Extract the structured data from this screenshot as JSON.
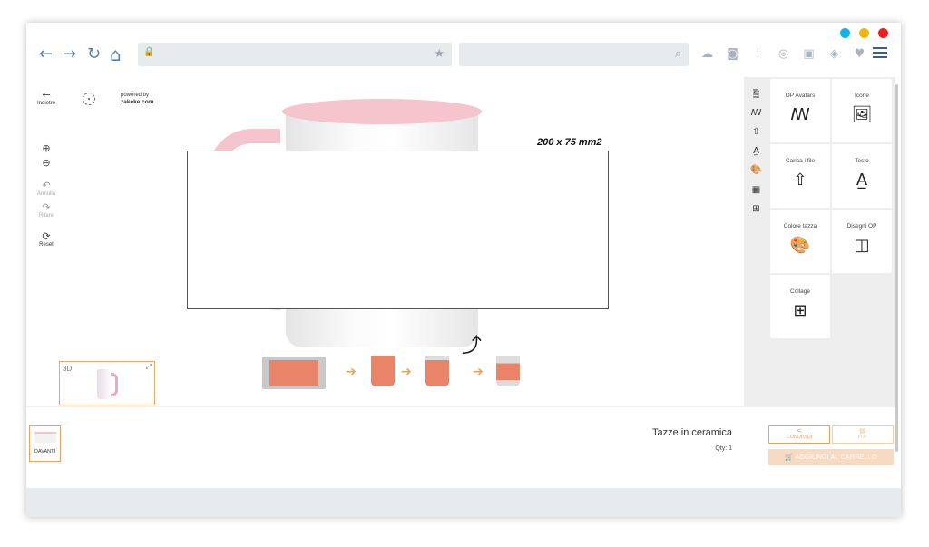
{
  "window": {
    "dot_colors": [
      "#0fb3ef",
      "#f5b800",
      "#ef1d1d"
    ]
  },
  "browser": {
    "back_glyph": "←",
    "forward_glyph": "→",
    "reload_glyph": "↻",
    "home_glyph": "⌂",
    "lock_glyph": "🔒",
    "star_glyph": "★",
    "search_glyph": "⌕",
    "toolbar_icons": [
      "cloud-upload-icon",
      "camera-icon",
      "alert-icon",
      "podcast-icon",
      "briefcase-icon",
      "shield-icon",
      "heart-icon"
    ],
    "toolbar_glyphs": [
      "☁",
      "◙",
      "!",
      "◎",
      "▣",
      "◈",
      "♥"
    ]
  },
  "left_tools": {
    "back_label": "Indietro",
    "back_glyph": "←",
    "zoom_in_glyph": "⊕",
    "zoom_out_glyph": "⊖",
    "undo_label": "Annulla",
    "undo_glyph": "↶",
    "redo_label": "Rifare",
    "redo_glyph": "↷",
    "reset_label": "Reset",
    "reset_glyph": "⟳"
  },
  "branding": {
    "powered_by": "powered by",
    "brand": "zakeke.com"
  },
  "canvas": {
    "dimensions_label": "200 x 75 mm2",
    "rotate_glyph": "⤴"
  },
  "preview3d": {
    "label": "3D",
    "expand_glyph": "⤢"
  },
  "side_strip": {
    "glyphs": [
      "🖺",
      "ꟿ",
      "⇧",
      "A̲",
      "🎨",
      "▦",
      "⊞"
    ]
  },
  "panel": {
    "items": [
      {
        "label": "OP Avatars",
        "glyph": "ꟿ"
      },
      {
        "label": "Icone",
        "glyph": "🖼"
      },
      {
        "label": "Carica i file",
        "glyph": "⇧"
      },
      {
        "label": "Testo",
        "glyph": "A̲"
      },
      {
        "label": "Colore tazza",
        "glyph": "🎨"
      },
      {
        "label": "Disegni OP",
        "glyph": "◫"
      },
      {
        "label": "Collage",
        "glyph": "⊞"
      }
    ]
  },
  "bottom": {
    "side_label": "DAVANTI",
    "product_title": "Tazze in ceramica",
    "qty": "Qty: 1",
    "share_label": "CONDIVIDI",
    "share_glyph": "<",
    "pdf_label": "PDF",
    "pdf_glyph": "▤",
    "cart_label": "🛒 AGGIUNGI AL CARRELLO"
  },
  "colors": {
    "accent": "#f29d5c",
    "mug_pink": "#f6c4cc",
    "print_orange": "#ea8468"
  }
}
